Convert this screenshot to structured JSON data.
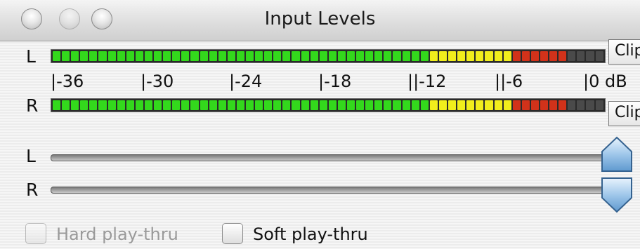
{
  "window": {
    "title": "Input Levels"
  },
  "meters": {
    "left_label": "L",
    "right_label": "R",
    "clip_label": "Clip",
    "segment_colors": {
      "green": "#33d81c",
      "yellow": "#f1ee1c",
      "red": "#d2321a",
      "off": "#4a4a4a"
    },
    "scale": [
      "|-36",
      "|-30",
      "|-24",
      "|-18",
      "||-12",
      "||-6",
      "|0 dB"
    ]
  },
  "sliders": {
    "left_label": "L",
    "right_label": "R",
    "left_level": 1.0,
    "right_level": 1.0
  },
  "options": {
    "hard_playthru": {
      "label": "Hard play-thru",
      "checked": false,
      "enabled": false
    },
    "soft_playthru": {
      "label": "Soft play-thru",
      "checked": false,
      "enabled": true
    }
  }
}
